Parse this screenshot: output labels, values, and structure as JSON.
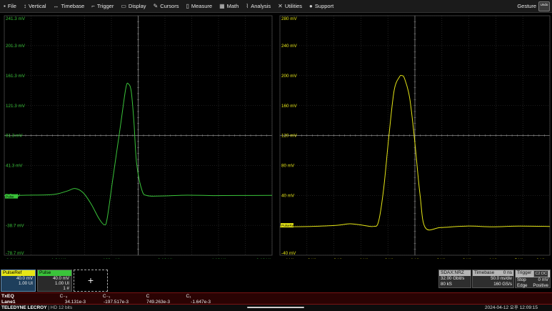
{
  "menu": [
    {
      "label": "File",
      "icon": "file-icon",
      "glyph": "▪"
    },
    {
      "label": "Vertical",
      "icon": "vertical-icon",
      "glyph": "↕"
    },
    {
      "label": "Timebase",
      "icon": "timebase-icon",
      "glyph": "↔"
    },
    {
      "label": "Trigger",
      "icon": "trigger-icon",
      "glyph": "⌐"
    },
    {
      "label": "Display",
      "icon": "display-icon",
      "glyph": "▭"
    },
    {
      "label": "Cursors",
      "icon": "cursors-icon",
      "glyph": "✎"
    },
    {
      "label": "Measure",
      "icon": "measure-icon",
      "glyph": "▯"
    },
    {
      "label": "Math",
      "icon": "math-icon",
      "glyph": "▦"
    },
    {
      "label": "Analysis",
      "icon": "analysis-icon",
      "glyph": "⌇"
    },
    {
      "label": "Utilities",
      "icon": "utilities-icon",
      "glyph": "✕"
    },
    {
      "label": "Support",
      "icon": "support-icon",
      "glyph": "●"
    }
  ],
  "gesture_label": "Gesture",
  "undo_label": "Undo",
  "colors": {
    "green": "#3ac43a",
    "yellow": "#e6e616",
    "grid": "#3a3a3a",
    "axis": "#8a8a8a"
  },
  "left_grid": {
    "y_labels": [
      "241.3 mV",
      "201.3 mV",
      "161.3 mV",
      "121.3 mV",
      "81.3 mV",
      "41.3 mV",
      "1.3 mV",
      "-38.7 mV",
      "-78.7 mV"
    ],
    "x_labels": [
      "-3.84 UI",
      "-1.84 UI",
      "160 mUI",
      "2.16 UI",
      "4.16 UI",
      "6.16 UI"
    ],
    "marker_label": "Pulse"
  },
  "right_grid": {
    "y_labels": [
      "280 mV",
      "240 mV",
      "200 mV",
      "160 mV",
      "120 mV",
      "80 mV",
      "40 mV",
      "0 mV",
      "-40 mV"
    ],
    "x_labels": [
      "-4 UI",
      "-3 UI",
      "-2 UI",
      "-1 UI",
      "0 UI",
      "1 UI",
      "2 UI",
      "3 UI",
      "4 UI",
      "5 UI",
      "6 UI"
    ],
    "marker_label": "PulseRef"
  },
  "chart_data": [
    {
      "type": "line",
      "name": "Pulse",
      "xlabel": "",
      "ylabel": "",
      "xlim": [
        -3.84,
        6.16
      ],
      "ylim": [
        -78.7,
        241.3
      ],
      "x": [
        -3.84,
        -3.0,
        -2.0,
        -1.5,
        -1.2,
        -0.9,
        -0.6,
        -0.3,
        -0.1,
        0.0,
        0.2,
        0.5,
        0.7,
        0.8,
        0.9,
        1.0,
        1.1,
        1.3,
        1.5,
        2.0,
        3.0,
        4.0,
        5.0,
        6.16
      ],
      "y": [
        1.0,
        1.5,
        2.5,
        7.0,
        10.5,
        5.0,
        -10.0,
        -30.0,
        -38.0,
        -30.0,
        20.0,
        95.0,
        145.0,
        150.0,
        140.0,
        100.0,
        45.0,
        8.0,
        1.0,
        0.5,
        1.5,
        1.0,
        1.2,
        1.3
      ]
    },
    {
      "type": "line",
      "name": "PulseRef",
      "xlabel": "",
      "ylabel": "",
      "xlim": [
        -4.2,
        6.2
      ],
      "ylim": [
        -40,
        280
      ],
      "x": [
        -4.2,
        -3.0,
        -2.0,
        -1.5,
        -1.0,
        -0.6,
        -0.4,
        -0.2,
        0.0,
        0.2,
        0.4,
        0.5,
        0.6,
        0.8,
        1.0,
        1.2,
        1.4,
        2.0,
        3.0,
        4.0,
        5.0,
        6.2
      ],
      "y": [
        -2.0,
        -1.5,
        0.0,
        2.0,
        0.0,
        -1.5,
        5.0,
        50.0,
        120.0,
        180.0,
        198.0,
        200.0,
        196.0,
        170.0,
        110.0,
        40.0,
        -3.0,
        -3.0,
        -1.0,
        -2.0,
        -1.0,
        -1.5
      ]
    }
  ],
  "descriptors": {
    "c1": {
      "name": "PulseRef",
      "scale": "40.0 mV",
      "timebase": "1.00 UI"
    },
    "c2": {
      "name": "Pulse",
      "scale": "40.0 mV",
      "timebase": "1.00 UI",
      "count": "1 #"
    },
    "add": "+"
  },
  "sdax": {
    "title": "SDAX:NRZ",
    "rate": "32.00 Gbit/s",
    "samples": "80 kS"
  },
  "timebase": {
    "title": "Timebase",
    "delay": "0 ns",
    "div": "50.0 ns/div",
    "rate": "160 GS/s"
  },
  "trigger": {
    "title": "Trigger",
    "badge": "C2 DC",
    "mode": "Stop",
    "level": "0 mV",
    "type": "Edge",
    "slope": "Positive"
  },
  "measurements": {
    "title1": "TxEQ",
    "title2": "Lane1",
    "cells": [
      {
        "header": "C₋₃",
        "value": "34.131e-3"
      },
      {
        "header": "C₋₁",
        "value": "-197.517e-3"
      },
      {
        "header": "C",
        "value": "749.263e-3"
      },
      {
        "header": "C₁",
        "value": "-1.647e-3"
      }
    ]
  },
  "status": {
    "brand": "TELEDYNE LECROY",
    "sub": "HD 12 bits",
    "datetime": "2024-04-12 오후 12:09:15"
  }
}
